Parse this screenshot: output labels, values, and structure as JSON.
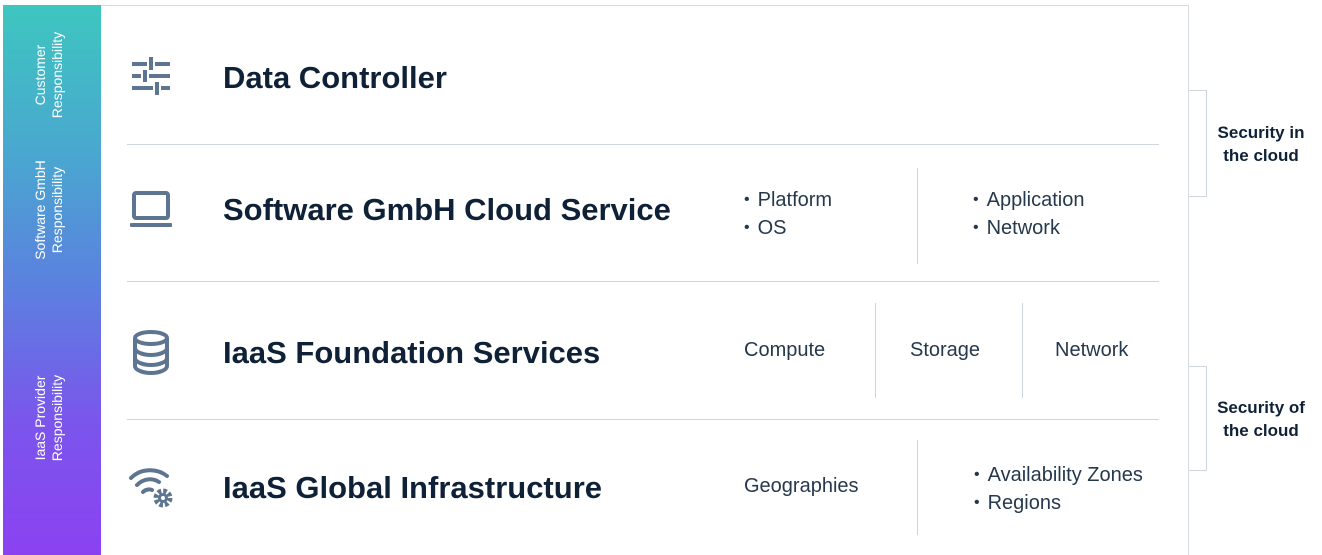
{
  "side_labels": [
    {
      "text": "Customer\nResponsibility"
    },
    {
      "text": "Software GmbH\nResponsibility"
    },
    {
      "text": "IaaS Provider\nResponsibility"
    }
  ],
  "layers": [
    {
      "title": "Data Controller",
      "icon": "sliders-icon"
    },
    {
      "title": "Software GmbH Cloud Service",
      "icon": "laptop-icon",
      "group_a": [
        "Platform",
        "OS"
      ],
      "group_b": [
        "Application",
        "Network"
      ]
    },
    {
      "title": "IaaS Foundation Services",
      "icon": "database-icon",
      "cells": [
        "Compute",
        "Storage",
        "Network"
      ]
    },
    {
      "title": "IaaS Global Infrastructure",
      "icon": "wifi-gear-icon",
      "single": "Geographies",
      "group_b": [
        "Availability Zones",
        "Regions"
      ]
    }
  ],
  "brackets": [
    {
      "label": "Security in\nthe cloud"
    },
    {
      "label": "Security of\nthe cloud"
    }
  ],
  "colors": {
    "text_dark": "#0f2137",
    "icon": "#5d7591",
    "divider": "#cfd5dc",
    "gradient_top": "#3ec6bf",
    "gradient_bottom": "#8a42f1"
  }
}
